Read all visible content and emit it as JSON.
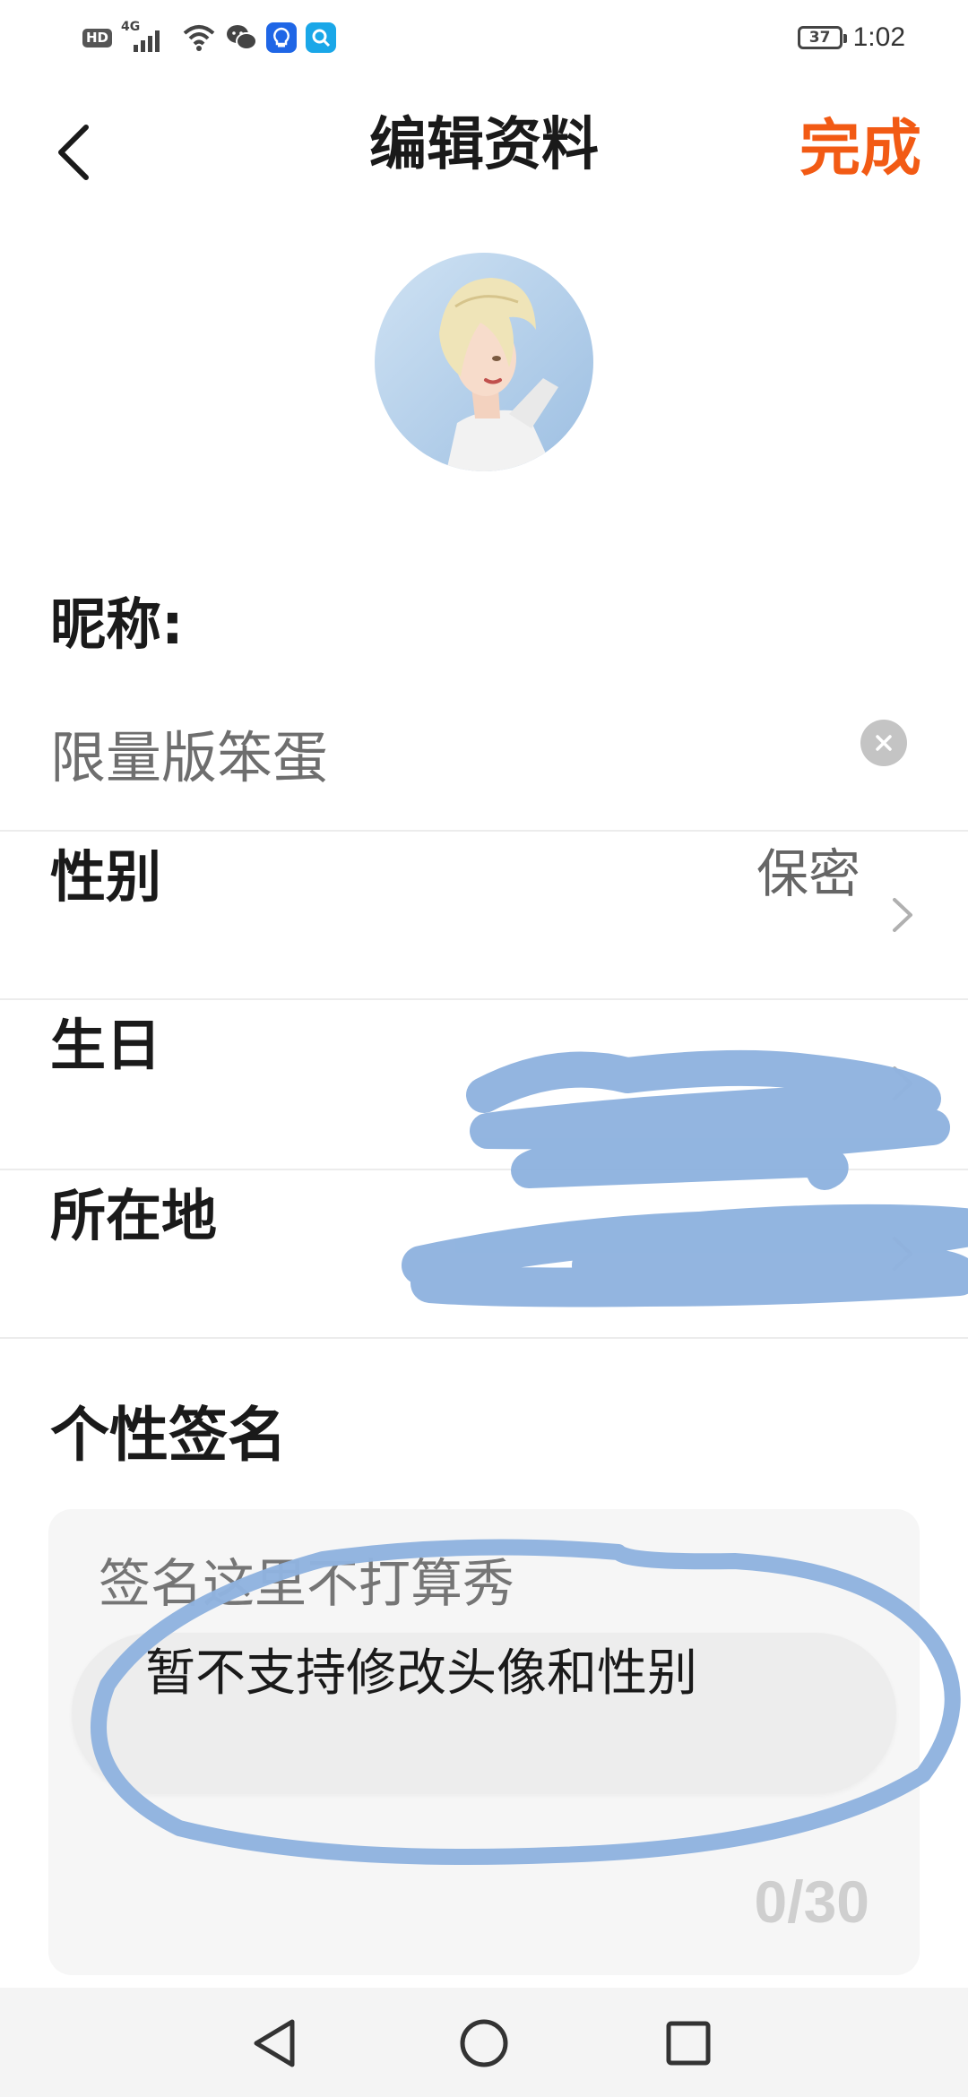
{
  "status_bar": {
    "hd": "HD",
    "network": "4G",
    "battery": "37",
    "time": "1:02"
  },
  "header": {
    "back_icon": "chevron-left-icon",
    "title": "编辑资料",
    "done_label": "完成"
  },
  "nickname": {
    "label": "昵称:",
    "value": "限量版笨蛋",
    "clear_icon": "clear-icon"
  },
  "rows": [
    {
      "label": "性别",
      "value": "保密"
    },
    {
      "label": "生日",
      "value": ""
    },
    {
      "label": "所在地",
      "value": ""
    }
  ],
  "signature": {
    "label": "个性签名",
    "placeholder": "签名这里不打算秀",
    "count": "0/30"
  },
  "toast": {
    "message": "暂不支持修改头像和性别"
  },
  "colors": {
    "accent": "#f25a14",
    "scribble": "#8fb3df"
  },
  "nav": {
    "back_icon": "triangle-back-icon",
    "home_icon": "circle-home-icon",
    "recents_icon": "square-recents-icon"
  }
}
